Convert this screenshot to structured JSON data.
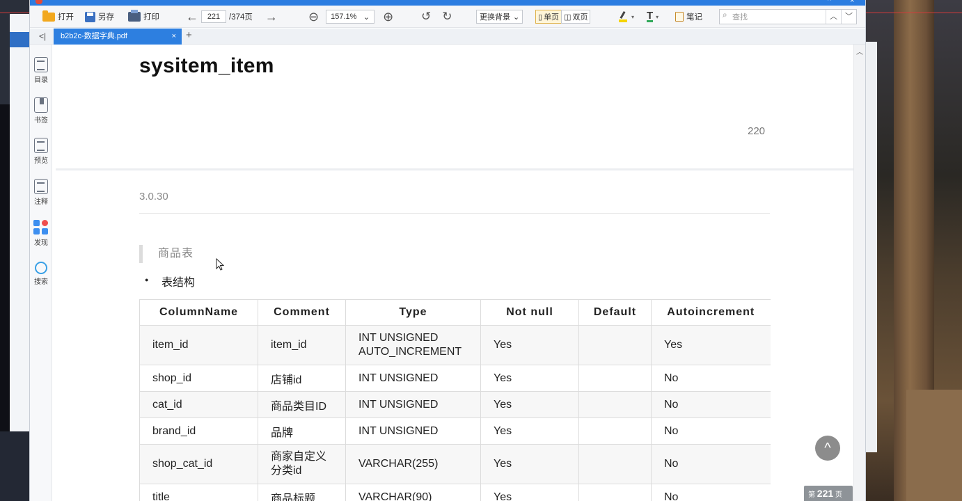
{
  "window": {
    "title": "",
    "controls": [
      "^",
      "×"
    ]
  },
  "toolbar": {
    "open_label": "打开",
    "saveas_label": "另存",
    "print_label": "打印",
    "page_current": "221",
    "page_total": "/374页",
    "zoom": "157.1%",
    "background_label": "更换背景",
    "single_page_label": "单页",
    "double_page_label": "双页",
    "notes_label": "笔记",
    "search_placeholder": "查找"
  },
  "tabs": [
    {
      "label": "b2b2c-数据字典.pdf",
      "close": "×"
    }
  ],
  "tab_add": "+",
  "tab_collapse": "<|",
  "sidenav": [
    {
      "label": "目录",
      "icon": "toc-icon"
    },
    {
      "label": "书签",
      "icon": "bookmark-icon"
    },
    {
      "label": "预览",
      "icon": "preview-icon"
    },
    {
      "label": "注释",
      "icon": "annotation-icon"
    },
    {
      "label": "发现",
      "icon": "discover-icon"
    },
    {
      "label": "搜索",
      "icon": "search-icon"
    }
  ],
  "document": {
    "heading": "sysitem_item",
    "page_number": "220",
    "version": "3.0.30",
    "quote": "商品表",
    "bullet": "表结构",
    "table": {
      "headers": [
        "ColumnName",
        "Comment",
        "Type",
        "Not null",
        "Default",
        "Autoincrement"
      ],
      "rows": [
        {
          "column": "item_id",
          "comment": "item_id",
          "type": "INT UNSIGNED AUTO_INCREMENT",
          "not_null": "Yes",
          "default": "",
          "autoincrement": "Yes"
        },
        {
          "column": "shop_id",
          "comment": "店铺id",
          "type": "INT UNSIGNED",
          "not_null": "Yes",
          "default": "",
          "autoincrement": "No"
        },
        {
          "column": "cat_id",
          "comment": "商品类目ID",
          "type": "INT UNSIGNED",
          "not_null": "Yes",
          "default": "",
          "autoincrement": "No"
        },
        {
          "column": "brand_id",
          "comment": "品牌",
          "type": "INT UNSIGNED",
          "not_null": "Yes",
          "default": "",
          "autoincrement": "No"
        },
        {
          "column": "shop_cat_id",
          "comment": "商家自定义分类id",
          "type": "VARCHAR(255)",
          "not_null": "Yes",
          "default": "",
          "autoincrement": "No"
        },
        {
          "column": "title",
          "comment": "商品标题",
          "type": "VARCHAR(90)",
          "not_null": "Yes",
          "default": "",
          "autoincrement": "No"
        }
      ]
    }
  },
  "back_to_top": "^",
  "page_indicator": {
    "prefix": "第",
    "number": "221",
    "suffix": "页"
  },
  "colors": {
    "accent": "#2d7fe0",
    "highlight": "#f5d400",
    "toolbar_bg": "#f5f6f8"
  }
}
